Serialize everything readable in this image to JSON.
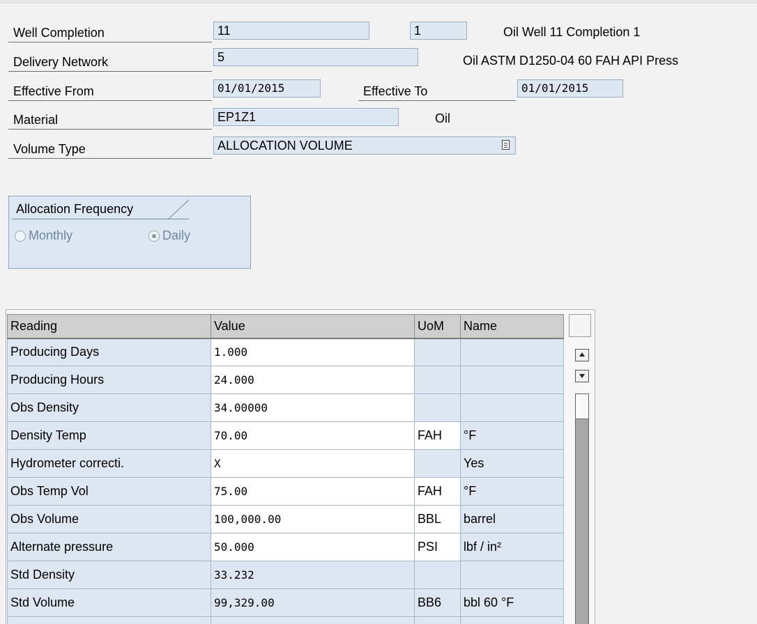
{
  "header": {
    "well_completion": {
      "label": "Well Completion",
      "value1": "11",
      "value2": "1",
      "desc": "Oil Well 11 Completion 1"
    },
    "delivery_network": {
      "label": "Delivery Network",
      "value": "5",
      "desc": "Oil ASTM D1250-04 60 FAH API Press"
    },
    "effective": {
      "from_label": "Effective From",
      "from_value": "01/01/2015",
      "to_label": "Effective To",
      "to_value": "01/01/2015"
    },
    "material": {
      "label": "Material",
      "value": "EP1Z1",
      "desc": "Oil"
    },
    "volume_type": {
      "label": "Volume Type",
      "value": "ALLOCATION VOLUME",
      "icon": "dropdown-list-icon"
    }
  },
  "allocation_frequency": {
    "title": "Allocation Frequency",
    "options": [
      {
        "label": "Monthly",
        "selected": false
      },
      {
        "label": "Daily",
        "selected": true
      }
    ]
  },
  "table": {
    "headers": {
      "reading": "Reading",
      "value": "Value",
      "uom": "UoM",
      "name": "Name"
    },
    "rows": [
      {
        "reading": "Producing Days",
        "value": "1.000",
        "uom": "",
        "name": ""
      },
      {
        "reading": "Producing Hours",
        "value": "24.000",
        "uom": "",
        "name": ""
      },
      {
        "reading": "Obs Density",
        "value": "34.00000",
        "uom": "",
        "name": ""
      },
      {
        "reading": "Density Temp",
        "value": "70.00",
        "uom": "FAH",
        "name": "°F"
      },
      {
        "reading": "Hydrometer correcti.",
        "value": "X",
        "uom": "",
        "name": "Yes"
      },
      {
        "reading": "Obs Temp Vol",
        "value": "75.00",
        "uom": "FAH",
        "name": "°F"
      },
      {
        "reading": "Obs Volume",
        "value": "100,000.00",
        "uom": "BBL",
        "name": "barrel"
      },
      {
        "reading": "Alternate pressure",
        "value": "50.000",
        "uom": "PSI",
        "name": "lbf / in²"
      },
      {
        "reading": "Std Density",
        "value": "33.232",
        "uom": "",
        "name": ""
      },
      {
        "reading": "Std Volume",
        "value": "99,329.00",
        "uom": "BB6",
        "name": "bbl 60 °F"
      },
      {
        "reading": "",
        "value": "",
        "uom": "",
        "name": ""
      }
    ]
  }
}
